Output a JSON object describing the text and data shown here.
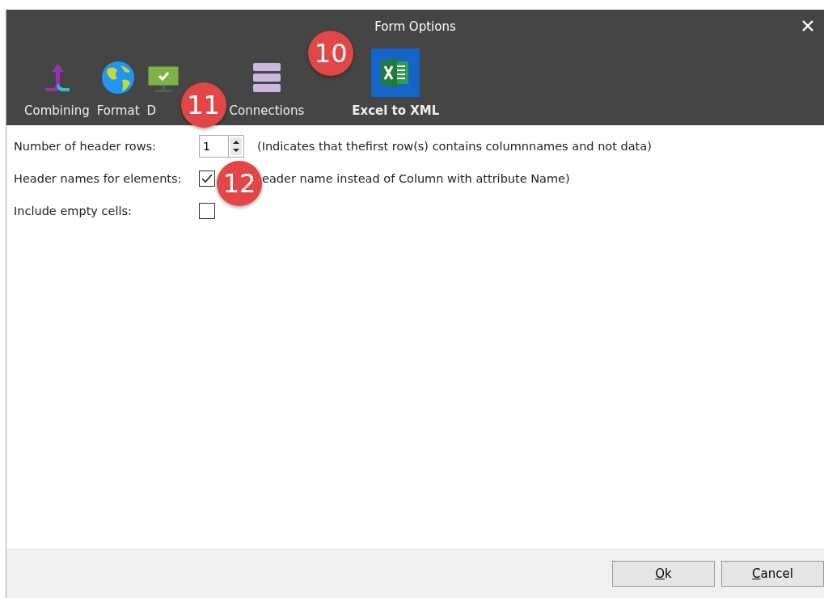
{
  "window": {
    "title": "Form Options"
  },
  "tabs": [
    {
      "label": "Combining",
      "selected": false
    },
    {
      "label": "Format",
      "selected": false
    },
    {
      "label": "D",
      "selected": false,
      "callout": "11"
    },
    {
      "label": "Connections",
      "selected": false
    },
    {
      "label": "Excel to XML",
      "selected": true,
      "callout": "10"
    }
  ],
  "options": [
    {
      "kind": "spinner",
      "label": "Number of header rows:",
      "value": "1",
      "note": "(Indicates that thefirst row(s) contains columnnames and not data)"
    },
    {
      "kind": "checkbox",
      "label": "Header names for elements:",
      "checked": true,
      "callout": "12",
      "note": "eader name instead of Column with attribute Name)"
    },
    {
      "kind": "checkbox",
      "label": "Include empty cells:",
      "checked": false
    }
  ],
  "buttons": [
    {
      "label": "Ok",
      "access_key_underlined": true
    },
    {
      "label": "Cancel",
      "access_key_underlined": true
    }
  ]
}
